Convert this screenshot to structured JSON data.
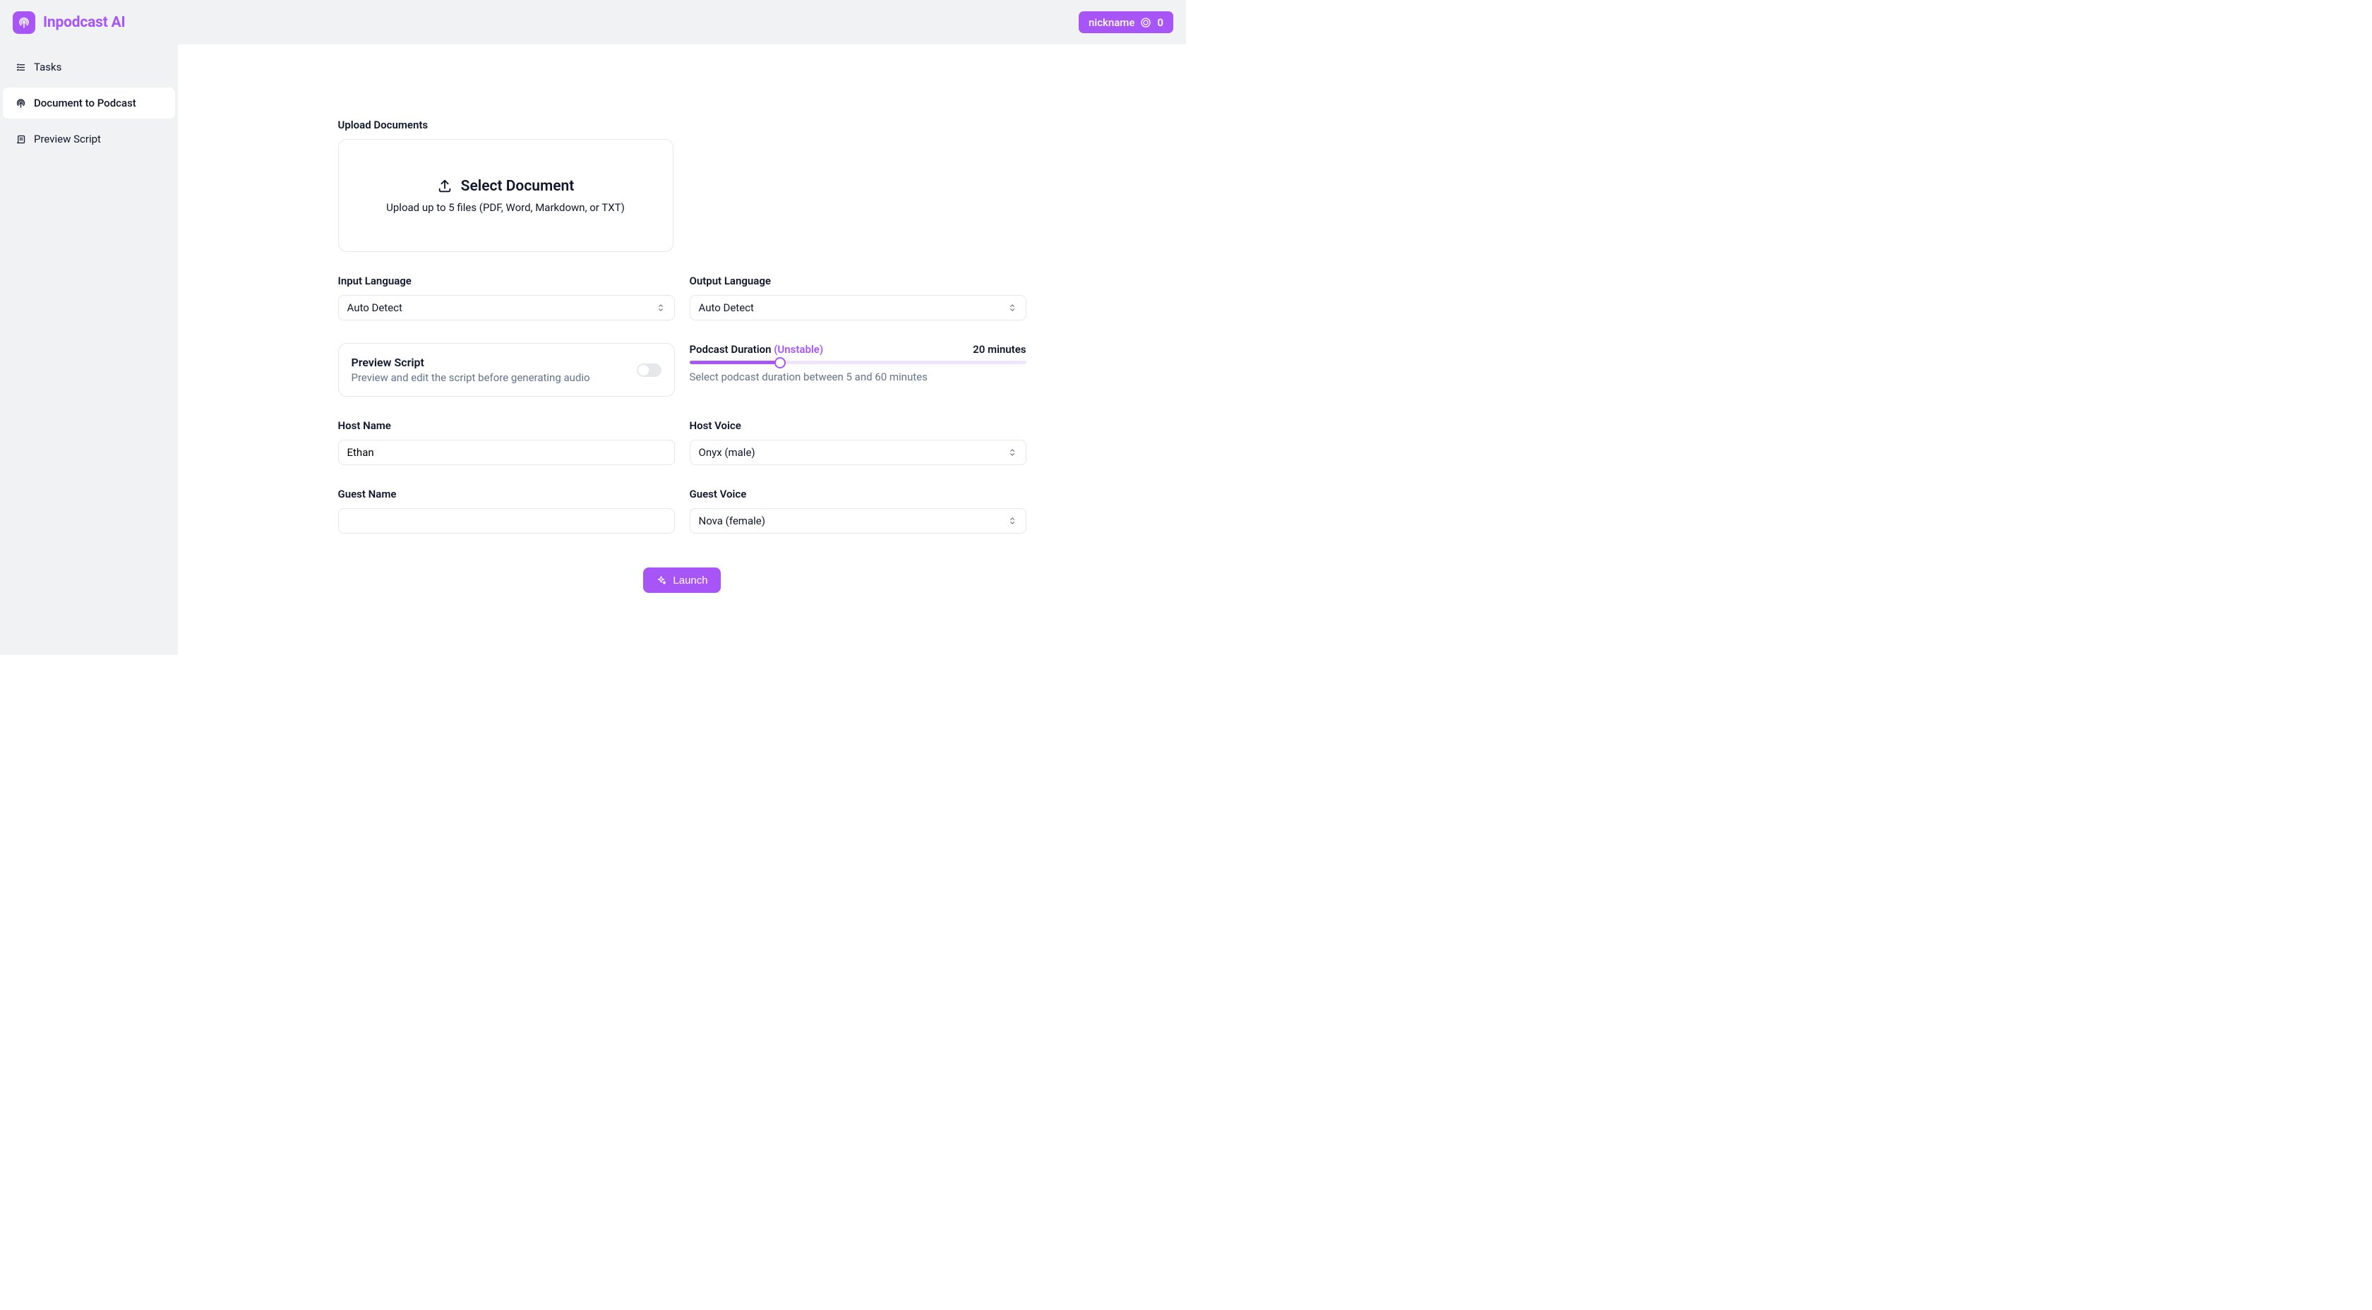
{
  "brand": {
    "name": "Inpodcast AI"
  },
  "header": {
    "user": {
      "nickname": "nickname",
      "coins": "0"
    }
  },
  "sidebar": {
    "items": [
      {
        "key": "tasks",
        "label": "Tasks",
        "icon": "checklist-icon",
        "active": false
      },
      {
        "key": "doc2podcast",
        "label": "Document to Podcast",
        "icon": "podcast-icon",
        "active": true
      },
      {
        "key": "preview-script",
        "label": "Preview Script",
        "icon": "scroll-icon",
        "active": false
      }
    ]
  },
  "form": {
    "upload": {
      "label": "Upload Documents",
      "cta": "Select Document",
      "hint": "Upload up to 5 files (PDF, Word, Markdown, or TXT)"
    },
    "input_lang": {
      "label": "Input Language",
      "value": "Auto Detect"
    },
    "output_lang": {
      "label": "Output Language",
      "value": "Auto Detect"
    },
    "preview_script": {
      "title": "Preview Script",
      "desc": "Preview and edit the script before generating audio",
      "enabled": false
    },
    "duration": {
      "label": "Podcast Duration",
      "badge": "(Unstable)",
      "value_label": "20 minutes",
      "hint": "Select podcast duration between 5 and 60 minutes",
      "min": 5,
      "max": 60,
      "value": 20
    },
    "host_name": {
      "label": "Host Name",
      "value": "Ethan"
    },
    "host_voice": {
      "label": "Host Voice",
      "value": "Onyx (male)"
    },
    "guest_name": {
      "label": "Guest Name",
      "value": ""
    },
    "guest_voice": {
      "label": "Guest Voice",
      "value": "Nova (female)"
    },
    "launch_label": "Launch"
  },
  "colors": {
    "accent": "#a855f7"
  }
}
